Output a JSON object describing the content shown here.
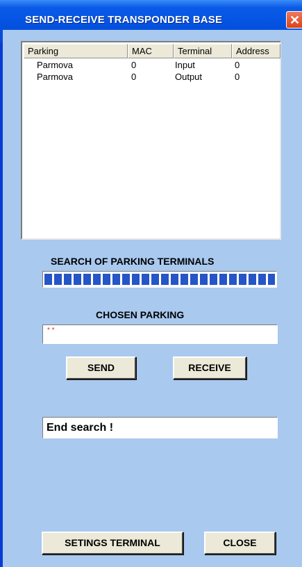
{
  "window": {
    "title": "SEND-RECEIVE TRANSPONDER BASE",
    "close_glyph": "✕"
  },
  "table": {
    "columns": [
      "Parking",
      "MAC",
      "Terminal",
      "Address"
    ],
    "rows": [
      [
        "Parmova",
        "0",
        "Input",
        "0"
      ],
      [
        "Parmova",
        "0",
        "Output",
        "0"
      ]
    ]
  },
  "search": {
    "label": "SEARCH OF PARKING TERMINALS",
    "progress_percent": 100
  },
  "chosen": {
    "label": "CHOSEN PARKING",
    "value": "* *"
  },
  "buttons": {
    "send": "SEND",
    "receive": "RECEIVE",
    "settings": "SETINGS TERMINAL",
    "close": "CLOSE"
  },
  "status": {
    "text": "End search !"
  }
}
